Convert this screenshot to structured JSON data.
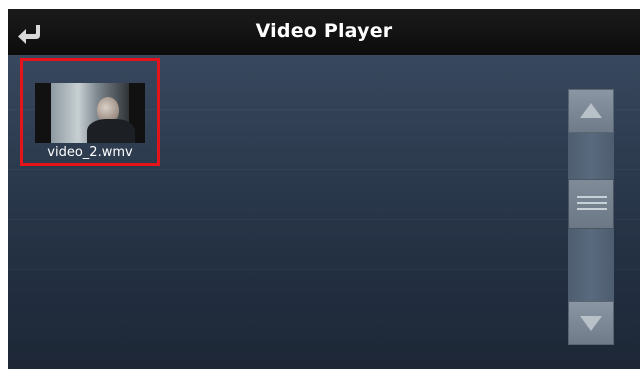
{
  "window": {
    "title": "Video Player"
  },
  "header": {
    "back_icon": "return-arrow-icon"
  },
  "files": [
    {
      "name": "video_2.wmv",
      "selected": true,
      "icon": "video-thumbnail"
    }
  ],
  "scrollbar": {
    "up_icon": "triangle-up-icon",
    "down_icon": "triangle-down-icon",
    "thumb_icon": "grip-lines-icon"
  },
  "colors": {
    "selection_border": "#e5141b",
    "title_bar": "#111111",
    "background": "#2e3c50"
  }
}
